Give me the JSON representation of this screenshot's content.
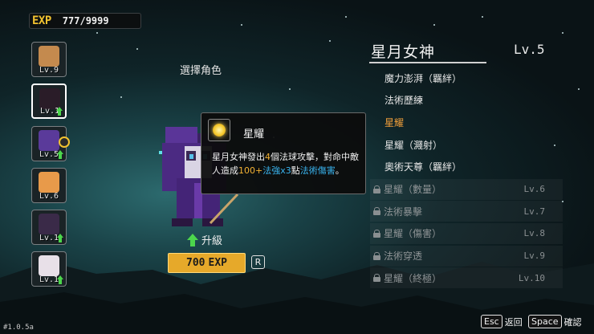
{
  "exp": {
    "label": "EXP",
    "value": "777/9999"
  },
  "select_title": "選擇角色",
  "heroes": [
    {
      "level": "Lv.9",
      "upgradable": false,
      "selected": false,
      "color": "#c48a4e"
    },
    {
      "level": "Lv.1",
      "upgradable": true,
      "selected": true,
      "color": "#2a1c28"
    },
    {
      "level": "Lv.5",
      "upgradable": true,
      "selected": false,
      "color": "#5a3a9a"
    },
    {
      "level": "Lv.6",
      "upgradable": false,
      "selected": false,
      "color": "#e89a4a"
    },
    {
      "level": "Lv.1",
      "upgradable": true,
      "selected": false,
      "color": "#3a2a48"
    },
    {
      "level": "Lv.1",
      "upgradable": true,
      "selected": false,
      "color": "#e8e0e8"
    }
  ],
  "tooltip": {
    "title": "星耀",
    "desc_parts": [
      {
        "text": "星月女神發出",
        "color": "white"
      },
      {
        "text": "4",
        "color": "orange"
      },
      {
        "text": "個法球攻擊，對命中敵人造成",
        "color": "white"
      },
      {
        "text": "100+",
        "color": "orange"
      },
      {
        "text": "法強x3",
        "color": "blue"
      },
      {
        "text": "點",
        "color": "white"
      },
      {
        "text": "法術傷害",
        "color": "blue"
      },
      {
        "text": "。",
        "color": "white"
      }
    ]
  },
  "upgrade": {
    "label": "升級"
  },
  "cost": {
    "amount": "700",
    "unit": "EXP",
    "hotkey": "R"
  },
  "hero_name": "星月女神",
  "hero_level": "Lv.5",
  "skills": [
    {
      "name": "魔力澎湃（羈絆）",
      "locked": false,
      "active": false,
      "level": ""
    },
    {
      "name": "法術歷練",
      "locked": false,
      "active": false,
      "level": ""
    },
    {
      "name": "星耀",
      "locked": false,
      "active": true,
      "level": ""
    },
    {
      "name": "星耀（濺射）",
      "locked": false,
      "active": false,
      "level": ""
    },
    {
      "name": "奧術天尊（羈絆）",
      "locked": false,
      "active": false,
      "level": ""
    },
    {
      "name": "星耀（數量）",
      "locked": true,
      "active": false,
      "level": "Lv.6"
    },
    {
      "name": "法術暴擊",
      "locked": true,
      "active": false,
      "level": "Lv.7"
    },
    {
      "name": "星耀（傷害）",
      "locked": true,
      "active": false,
      "level": "Lv.8"
    },
    {
      "name": "法術穿透",
      "locked": true,
      "active": false,
      "level": "Lv.9"
    },
    {
      "name": "星耀（終極）",
      "locked": true,
      "active": false,
      "level": "Lv.10"
    }
  ],
  "footer": {
    "version": "#1.0.5a",
    "esc_key": "Esc",
    "esc_label": "返回",
    "space_key": "Space",
    "space_label": "確認"
  }
}
